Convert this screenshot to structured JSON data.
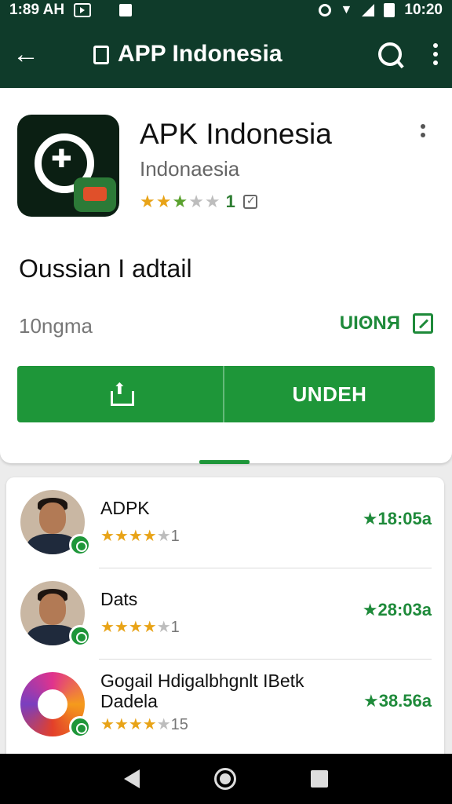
{
  "status_bar": {
    "time_left": "1:89 AH",
    "time_right": "10:20",
    "icons": [
      "video-icon",
      "notification-icon",
      "alarm-icon",
      "wifi-icon",
      "signal-icon",
      "battery-icon"
    ]
  },
  "app_bar": {
    "title": "APP Indonesia",
    "icons": [
      "back-arrow-icon",
      "app-title-icon",
      "search-icon",
      "overflow-menu-icon"
    ]
  },
  "app_header": {
    "name": "APK Indonesia",
    "developer": "Indonaesia",
    "rating_stars": "★★★★★",
    "rating_count": "1",
    "stars_on": 3,
    "stars_total": 5
  },
  "section": {
    "title": "Oussian  I adtail",
    "meta_left": "10ngma",
    "meta_right": "UIʘNЯ"
  },
  "actions": {
    "install_icon": "install-icon",
    "update_label": "UNDEH"
  },
  "list": {
    "items": [
      {
        "title": "ADPK",
        "stars": "★★★★★",
        "count": "1",
        "price": "★18:05a",
        "avatar": "person"
      },
      {
        "title": "Dats",
        "stars": "★★★★★",
        "count": "1",
        "price": "★28:03a",
        "avatar": "person"
      },
      {
        "title": "Gogail Hdigalbhgnlt IBetk\nDadela",
        "stars": "★★★★★",
        "count": "15",
        "price": "★38.56a",
        "avatar": "colorful"
      }
    ]
  },
  "colors": {
    "app_bar": "#0f3b2a",
    "accent": "#1e9639",
    "star": "#e8a317"
  }
}
